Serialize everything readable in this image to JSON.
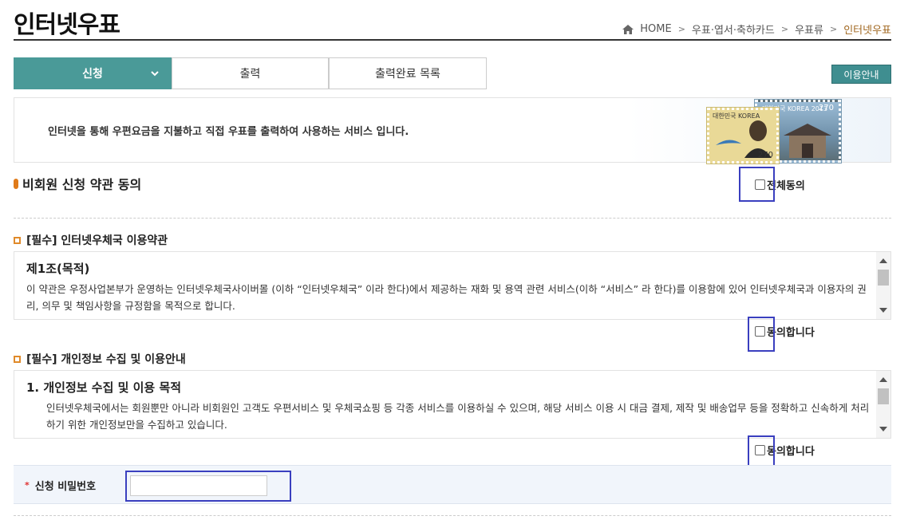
{
  "page": {
    "title": "인터넷우표"
  },
  "breadcrumb": {
    "items": [
      "HOME",
      "우표·엽서·축하카드",
      "우표류",
      "인터넷우표"
    ]
  },
  "tabs": [
    {
      "label": "신청"
    },
    {
      "label": "출력"
    },
    {
      "label": "출력완료 목록"
    }
  ],
  "guide_button": "이용안내",
  "intro": {
    "text": "인터넷을 통해 우편요금을 지불하고 직접 우표를 출력하여 사용하는 서비스 입니다.",
    "stamp1_label": "대한민국 KOREA",
    "stamp1_value": "270",
    "stamp2_label": "대한민국 KOREA 2013",
    "stamp2_value": "270"
  },
  "agreement": {
    "title": "비회원 신청 약관 동의",
    "all_agree_label": "전체동의"
  },
  "terms": [
    {
      "title": "[필수] 인터넷우체국 이용약관",
      "heading": "제1조(목적)",
      "body": "이 약관은 우정사업본부가 운영하는 인터넷우체국사이버몰 (이하 “인터넷우체국” 이라 한다)에서 제공하는 재화 및 용역 관련 서비스(이하 “서비스” 라 한다)를 이용함에 있어 인터넷우체국과 이용자의 권리, 의무 및 책임사항을 규정함을 목적으로 합니다.",
      "agree_label": "동의합니다"
    },
    {
      "title": "[필수] 개인정보 수집 및 이용안내",
      "heading": "1. 개인정보 수집 및 이용 목적",
      "body": "인터넷우체국에서는 회원뿐만 아니라 비회원인 고객도 우편서비스 및 우체국쇼핑 등 각종 서비스를 이용하실 수 있으며, 해당 서비스 이용 시 대금 결제, 제작 및 배송업무 등을 정확하고 신속하게 처리하기 위한 개인정보만을 수집하고 있습니다.",
      "agree_label": "동의합니다"
    }
  ],
  "password": {
    "label": "신청 비밀번호",
    "required_mark": "*",
    "value": ""
  }
}
